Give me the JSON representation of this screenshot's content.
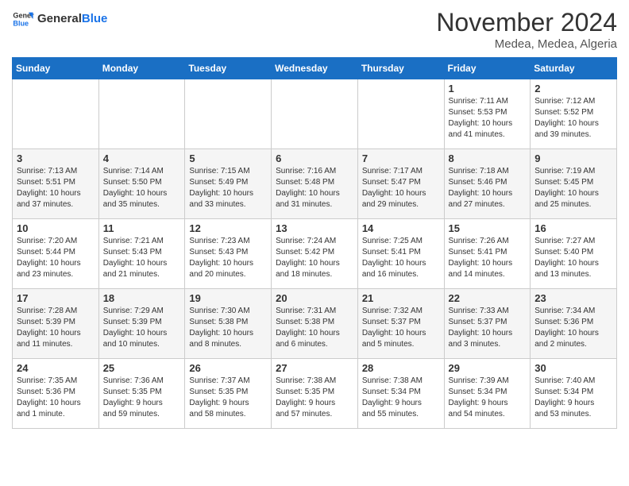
{
  "logo": {
    "line1": "General",
    "line2": "Blue"
  },
  "title": "November 2024",
  "subtitle": "Medea, Medea, Algeria",
  "headers": [
    "Sunday",
    "Monday",
    "Tuesday",
    "Wednesday",
    "Thursday",
    "Friday",
    "Saturday"
  ],
  "weeks": [
    [
      {
        "day": "",
        "info": ""
      },
      {
        "day": "",
        "info": ""
      },
      {
        "day": "",
        "info": ""
      },
      {
        "day": "",
        "info": ""
      },
      {
        "day": "",
        "info": ""
      },
      {
        "day": "1",
        "info": "Sunrise: 7:11 AM\nSunset: 5:53 PM\nDaylight: 10 hours\nand 41 minutes."
      },
      {
        "day": "2",
        "info": "Sunrise: 7:12 AM\nSunset: 5:52 PM\nDaylight: 10 hours\nand 39 minutes."
      }
    ],
    [
      {
        "day": "3",
        "info": "Sunrise: 7:13 AM\nSunset: 5:51 PM\nDaylight: 10 hours\nand 37 minutes."
      },
      {
        "day": "4",
        "info": "Sunrise: 7:14 AM\nSunset: 5:50 PM\nDaylight: 10 hours\nand 35 minutes."
      },
      {
        "day": "5",
        "info": "Sunrise: 7:15 AM\nSunset: 5:49 PM\nDaylight: 10 hours\nand 33 minutes."
      },
      {
        "day": "6",
        "info": "Sunrise: 7:16 AM\nSunset: 5:48 PM\nDaylight: 10 hours\nand 31 minutes."
      },
      {
        "day": "7",
        "info": "Sunrise: 7:17 AM\nSunset: 5:47 PM\nDaylight: 10 hours\nand 29 minutes."
      },
      {
        "day": "8",
        "info": "Sunrise: 7:18 AM\nSunset: 5:46 PM\nDaylight: 10 hours\nand 27 minutes."
      },
      {
        "day": "9",
        "info": "Sunrise: 7:19 AM\nSunset: 5:45 PM\nDaylight: 10 hours\nand 25 minutes."
      }
    ],
    [
      {
        "day": "10",
        "info": "Sunrise: 7:20 AM\nSunset: 5:44 PM\nDaylight: 10 hours\nand 23 minutes."
      },
      {
        "day": "11",
        "info": "Sunrise: 7:21 AM\nSunset: 5:43 PM\nDaylight: 10 hours\nand 21 minutes."
      },
      {
        "day": "12",
        "info": "Sunrise: 7:23 AM\nSunset: 5:43 PM\nDaylight: 10 hours\nand 20 minutes."
      },
      {
        "day": "13",
        "info": "Sunrise: 7:24 AM\nSunset: 5:42 PM\nDaylight: 10 hours\nand 18 minutes."
      },
      {
        "day": "14",
        "info": "Sunrise: 7:25 AM\nSunset: 5:41 PM\nDaylight: 10 hours\nand 16 minutes."
      },
      {
        "day": "15",
        "info": "Sunrise: 7:26 AM\nSunset: 5:41 PM\nDaylight: 10 hours\nand 14 minutes."
      },
      {
        "day": "16",
        "info": "Sunrise: 7:27 AM\nSunset: 5:40 PM\nDaylight: 10 hours\nand 13 minutes."
      }
    ],
    [
      {
        "day": "17",
        "info": "Sunrise: 7:28 AM\nSunset: 5:39 PM\nDaylight: 10 hours\nand 11 minutes."
      },
      {
        "day": "18",
        "info": "Sunrise: 7:29 AM\nSunset: 5:39 PM\nDaylight: 10 hours\nand 10 minutes."
      },
      {
        "day": "19",
        "info": "Sunrise: 7:30 AM\nSunset: 5:38 PM\nDaylight: 10 hours\nand 8 minutes."
      },
      {
        "day": "20",
        "info": "Sunrise: 7:31 AM\nSunset: 5:38 PM\nDaylight: 10 hours\nand 6 minutes."
      },
      {
        "day": "21",
        "info": "Sunrise: 7:32 AM\nSunset: 5:37 PM\nDaylight: 10 hours\nand 5 minutes."
      },
      {
        "day": "22",
        "info": "Sunrise: 7:33 AM\nSunset: 5:37 PM\nDaylight: 10 hours\nand 3 minutes."
      },
      {
        "day": "23",
        "info": "Sunrise: 7:34 AM\nSunset: 5:36 PM\nDaylight: 10 hours\nand 2 minutes."
      }
    ],
    [
      {
        "day": "24",
        "info": "Sunrise: 7:35 AM\nSunset: 5:36 PM\nDaylight: 10 hours\nand 1 minute."
      },
      {
        "day": "25",
        "info": "Sunrise: 7:36 AM\nSunset: 5:35 PM\nDaylight: 9 hours\nand 59 minutes."
      },
      {
        "day": "26",
        "info": "Sunrise: 7:37 AM\nSunset: 5:35 PM\nDaylight: 9 hours\nand 58 minutes."
      },
      {
        "day": "27",
        "info": "Sunrise: 7:38 AM\nSunset: 5:35 PM\nDaylight: 9 hours\nand 57 minutes."
      },
      {
        "day": "28",
        "info": "Sunrise: 7:38 AM\nSunset: 5:34 PM\nDaylight: 9 hours\nand 55 minutes."
      },
      {
        "day": "29",
        "info": "Sunrise: 7:39 AM\nSunset: 5:34 PM\nDaylight: 9 hours\nand 54 minutes."
      },
      {
        "day": "30",
        "info": "Sunrise: 7:40 AM\nSunset: 5:34 PM\nDaylight: 9 hours\nand 53 minutes."
      }
    ]
  ]
}
